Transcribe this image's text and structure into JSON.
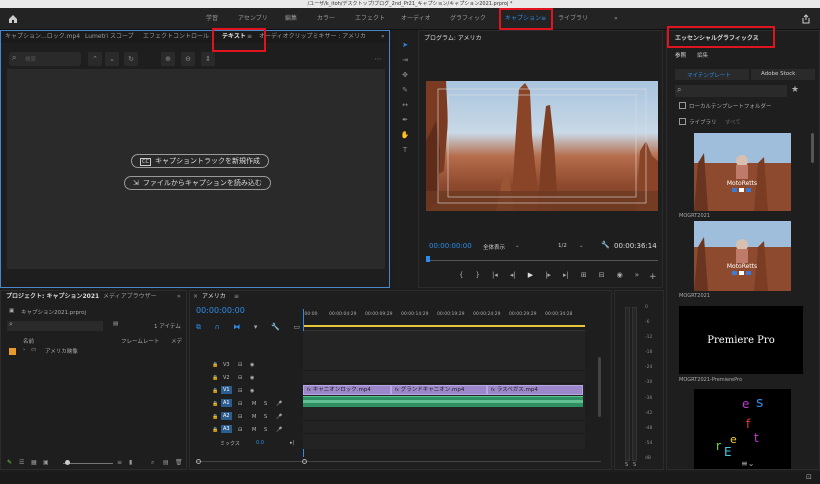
{
  "window": {
    "title": "/ユーザ/k_itoh/デスクトップ/ブログ_2nd_Pr21_キャプション/キャプション2021.prproj *"
  },
  "workspaces": [
    "学習",
    "アセンブリ",
    "編集",
    "カラー",
    "エフェクト",
    "オーディオ",
    "グラフィック",
    "キャプション",
    "ライブラリ"
  ],
  "workspace_active_index": 7,
  "left_panel": {
    "tabs": [
      "キャプション...ロック.mp4",
      "Lumetri スコープ",
      "エフェクトコントロール",
      "テキスト",
      "オーディオクリップミキサー : アメリカ"
    ],
    "active_tab_index": 3,
    "search_placeholder": "検索",
    "btn_new_track": "キャプショントラックを新規作成",
    "btn_import": "ファイルからキャプションを読み込む"
  },
  "program": {
    "title": "プログラム: アメリカ",
    "timecode": "00:00:00:00",
    "fit": "全体表示",
    "quality": "1/2",
    "duration": "00:00:36:14"
  },
  "essential": {
    "title": "エッセンシャルグラフィックス",
    "tabs": [
      "参照",
      "編集"
    ],
    "subtabs": [
      "マイテンプレート",
      "Adobe Stock"
    ],
    "local_templates": "ローカルテンプレートフォルダー",
    "libraries": "ライブラリ",
    "libraries_value": "すべて",
    "items": [
      {
        "label": "MOGRT2021",
        "brand": "MotoRetts"
      },
      {
        "label": "MOGRT2021",
        "brand": "MotoRetts"
      },
      {
        "label": "MOGRT2021-PremierePro",
        "text": "Premiere Pro"
      },
      {
        "label": "",
        "letters": [
          "e",
          "s",
          "f",
          "e",
          "r",
          "E",
          "t"
        ]
      }
    ]
  },
  "project": {
    "tabs": [
      "プロジェクト: キャプション2021",
      "メディアブラウザー"
    ],
    "file": "キャプション2021.prproj",
    "items_count": "1 アイテム",
    "col_name": "名前",
    "col_fps": "フレームレート",
    "col_media": "メデ",
    "bin": "アメリカ映像"
  },
  "timeline": {
    "tab": "アメリカ",
    "timecode": "00:00:00:00",
    "ruler": [
      ":00:00",
      "00:00:04:29",
      "00:00:09:29",
      "00:00:14:29",
      "00:00:19:29",
      "00:00:24:29",
      "00:00:29:29",
      "00:00:34:28"
    ],
    "video_tracks": [
      "V3",
      "V2",
      "V1"
    ],
    "audio_tracks": [
      "A1",
      "A2",
      "A3"
    ],
    "mix": "ミックス",
    "mix_value": "0.0",
    "clips": [
      "キャニオンロック.mp4",
      "グランドキャニオン.mp4",
      "ラスベガス.mp4"
    ]
  },
  "meter": {
    "scale": [
      "0",
      "-6",
      "-12",
      "-18",
      "-24",
      "-30",
      "-36",
      "-42",
      "-48",
      "-54",
      "dB"
    ]
  },
  "colors": {
    "accent": "#2d8ceb",
    "highlight": "#e0141e",
    "clip": "#9b87c9"
  }
}
